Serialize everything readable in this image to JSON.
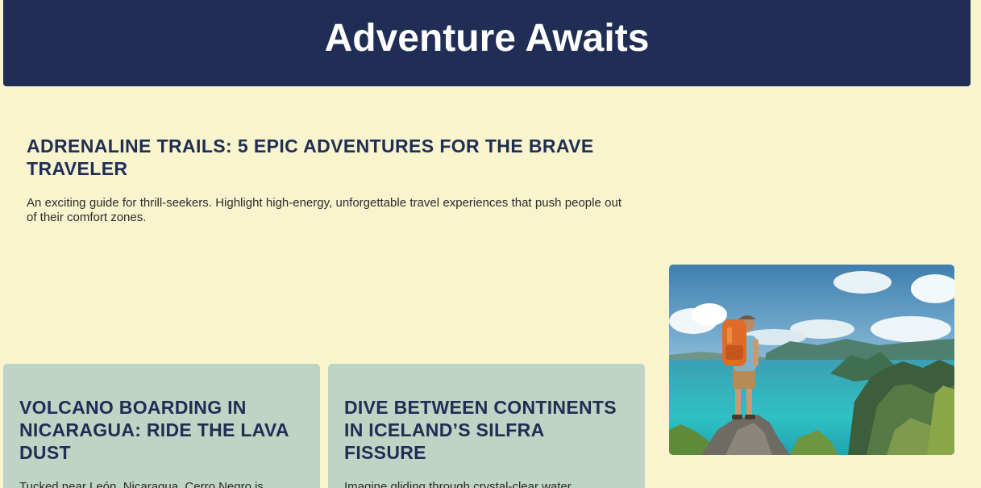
{
  "header": {
    "title": "Adventure Awaits"
  },
  "intro": {
    "heading": "ADRENALINE TRAILS: 5 EPIC ADVENTURES FOR THE BRAVE TRAVELER",
    "description": "An exciting guide for thrill-seekers. Highlight high-energy, unforgettable travel experiences that push people out of their comfort zones."
  },
  "cards": [
    {
      "title": "VOLCANO BOARDING IN NICARAGUA: RIDE THE LAVA DUST",
      "text": "Tucked near León, Nicaragua, Cerro Negro is"
    },
    {
      "title": "DIVE BETWEEN CONTINENTS IN ICELAND’S SILFRA FISSURE",
      "text": "Imagine gliding through crystal-clear water"
    }
  ],
  "photo": {
    "subject": "hiker-with-backpack-overlooking-tropical-bay"
  },
  "colors": {
    "background": "#f7f4ce",
    "header": "#202d54",
    "card": "#bed4c5",
    "heading": "#202d54"
  }
}
